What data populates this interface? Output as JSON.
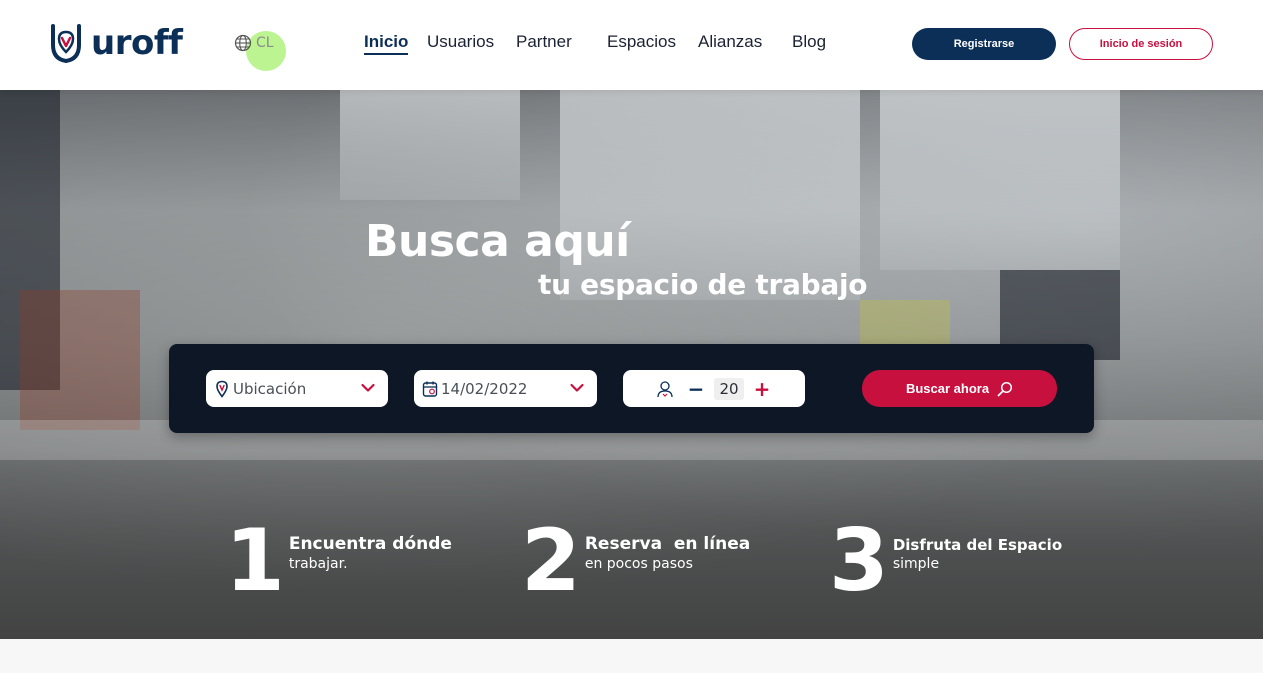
{
  "brand": {
    "name": "uroff",
    "logo_icon": "location-pin-shield-icon",
    "primary_color": "#0c2f57",
    "accent_color": "#c8103f"
  },
  "language": {
    "icon": "globe-icon",
    "code": "CL"
  },
  "nav": {
    "items": [
      {
        "label": "Inicio",
        "active": true
      },
      {
        "label": "Usuarios",
        "active": false
      },
      {
        "label": "Partner",
        "active": false
      },
      {
        "label": "Espacios",
        "active": false
      },
      {
        "label": "Alianzas",
        "active": false
      },
      {
        "label": "Blog",
        "active": false
      }
    ]
  },
  "auth": {
    "register_label": "Registrarse",
    "login_label": "Inicio de sesión"
  },
  "hero": {
    "title": "Busca aquí",
    "subtitle": "tu espacio de trabajo"
  },
  "search": {
    "location": {
      "icon": "map-pin-icon",
      "value": "Ubicación"
    },
    "date": {
      "icon": "calendar-icon",
      "value": "14/02/2022"
    },
    "people": {
      "icon": "person-icon",
      "minus": "−",
      "value": "20",
      "plus": "+"
    },
    "button_label": "Buscar ahora",
    "button_icon": "search-icon"
  },
  "steps": [
    {
      "number": "1",
      "title": "Encuentra dónde",
      "subtitle": "trabajar."
    },
    {
      "number": "2",
      "title": "Reserva  en línea",
      "subtitle": "en pocos pasos"
    },
    {
      "number": "3",
      "title": "Disfruta del Espacio",
      "subtitle": "simple"
    }
  ]
}
